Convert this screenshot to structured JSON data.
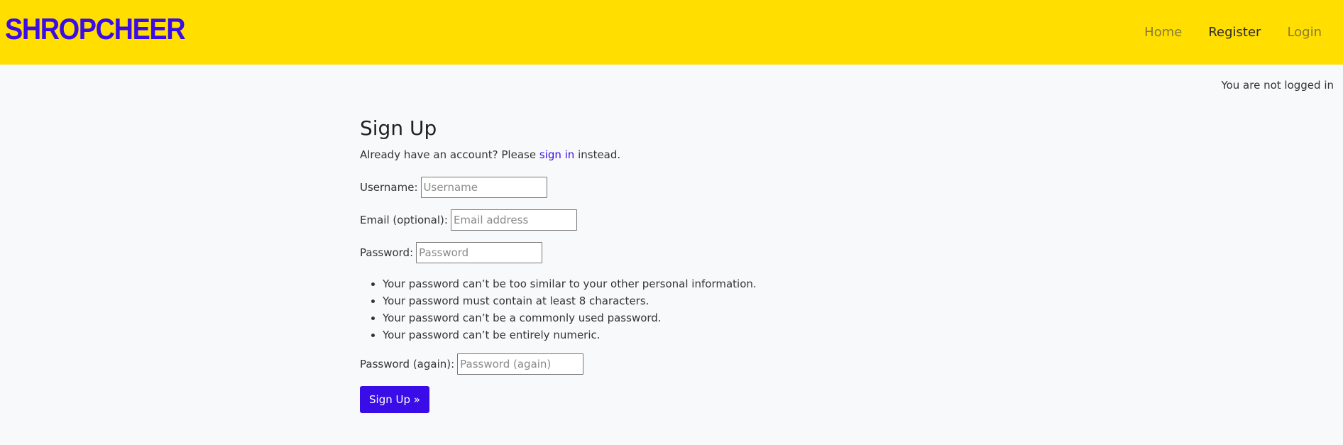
{
  "navbar": {
    "brand": "SHROPCHEER",
    "links": [
      "Home",
      "Register",
      "Login"
    ],
    "active": "Register"
  },
  "status_text": "You are not logged in",
  "form": {
    "title": "Sign Up",
    "subtitle_prefix": "Already have an account?  Please",
    "subtitle_link": "sign in",
    "subtitle_suffix": "instead.",
    "username_label": "Username:",
    "username_placeholder": "Username",
    "email_label": "Email (optional):",
    "email_placeholder": "Email address",
    "password_label": "Password:",
    "password_placeholder": "Password",
    "password_help": [
      "Your password can’t be too similar to your other personal information.",
      "Your password must contain at least 8 characters.",
      "Your password can’t be a commonly used password.",
      "Your password can’t be entirely numeric."
    ],
    "password2_label": "Password (again):",
    "password2_placeholder": "Password (again)",
    "submit_label": "Sign Up »"
  },
  "colors": {
    "navbar_bg": "#ffde00",
    "brand": "#3a0ce8",
    "accent": "#3a0ce8"
  }
}
